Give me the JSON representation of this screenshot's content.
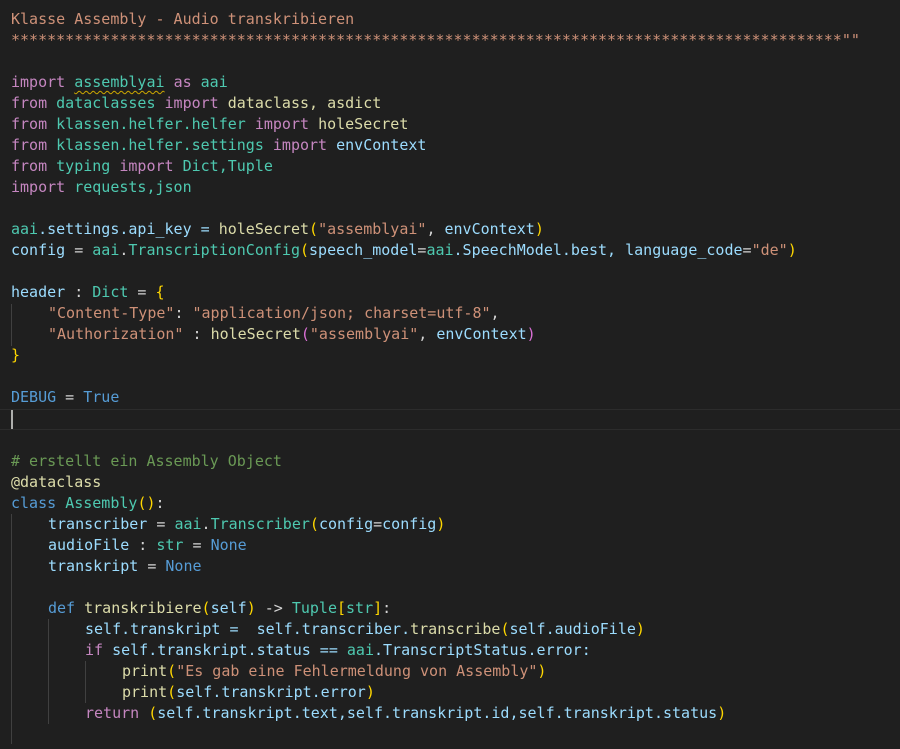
{
  "doc": {
    "l1": "Klasse Assembly - Audio transkribieren",
    "l2": "********************************************************************************************\"\"",
    "imp1_kw": "import",
    "imp1_mod": "assemblyai",
    "imp1_as": "as",
    "imp1_alias": "aai",
    "imp2_from": "from",
    "imp2_mod": "dataclasses",
    "imp2_import": "import",
    "imp2_names": "dataclass, asdict",
    "imp3_from": "from",
    "imp3_mod": "klassen.helfer.helfer",
    "imp3_import": "import",
    "imp3_names": "holeSecret",
    "imp4_from": "from",
    "imp4_mod": "klassen.helfer.settings",
    "imp4_import": "import",
    "imp4_names": "envContext",
    "imp5_from": "from",
    "imp5_mod": "typing",
    "imp5_import": "import",
    "imp5_names": "Dict,Tuple",
    "imp6_kw": "import",
    "imp6_names": "requests,json",
    "cfg1_a": "aai",
    "cfg1_b": ".settings.api_key = ",
    "cfg1_fn": "holeSecret",
    "cfg1_open": "(",
    "cfg1_str": "\"assemblyai\"",
    "cfg1_sep": ", ",
    "cfg1_arg": "envContext",
    "cfg1_close": ")",
    "cfg2_var": "config",
    "cfg2_eq": " = ",
    "cfg2_a": "aai",
    "cfg2_dot": ".",
    "cfg2_cls": "TranscriptionConfig",
    "cfg2_open": "(",
    "cfg2_p1": "speech_model",
    "cfg2_eq2": "=",
    "cfg2_a2": "aai",
    "cfg2_val": ".SpeechModel.best, ",
    "cfg2_p2": "language_code",
    "cfg2_eq3": "=",
    "cfg2_str": "\"de\"",
    "cfg2_close": ")",
    "hdr_var": "header",
    "hdr_colon": " : ",
    "hdr_type": "Dict",
    "hdr_eq": " = ",
    "hdr_open": "{",
    "hdr_k1": "\"Content-Type\"",
    "hdr_c1": ": ",
    "hdr_v1": "\"application/json; charset=utf-8\"",
    "hdr_comma": ",",
    "hdr_k2": "\"Authorization\"",
    "hdr_c2": " : ",
    "hdr_fn": "holeSecret",
    "hdr_p_open": "(",
    "hdr_v2": "\"assemblyai\"",
    "hdr_sep": ", ",
    "hdr_arg": "envContext",
    "hdr_p_close": ")",
    "hdr_close": "}",
    "dbg_var": "DEBUG",
    "dbg_eq": " = ",
    "dbg_val": "True",
    "comment": "# erstellt ein Assembly Object",
    "decorator": "@dataclass",
    "cls_kw": "class",
    "cls_name": "Assembly",
    "cls_paren": "()",
    "cls_colon": ":",
    "tr_var": "transcriber",
    "tr_eq": " = ",
    "tr_a": "aai",
    "tr_dot": ".",
    "tr_cls": "Transcriber",
    "tr_open": "(",
    "tr_p": "config",
    "tr_eq2": "=",
    "tr_arg": "config",
    "tr_close": ")",
    "af_var": "audioFile",
    "af_colon": " : ",
    "af_type": "str",
    "af_eq": " = ",
    "af_val": "None",
    "tk_var": "transkript",
    "tk_eq": " = ",
    "tk_val": "None",
    "def_kw": "def",
    "def_name": "transkribiere",
    "def_open": "(",
    "def_self": "self",
    "def_close": ")",
    "def_arrow": " -> ",
    "def_ret": "Tuple",
    "def_bo": "[",
    "def_str": "str",
    "def_bc": "]",
    "def_colon": ":",
    "b1_self": "self",
    "b1_attr": ".transkript = ",
    "b1_self2": "self",
    "b1_attr2": ".transcriber.",
    "b1_fn": "transcribe",
    "b1_open": "(",
    "b1_self3": "self",
    "b1_arg": ".audioFile",
    "b1_close": ")",
    "b2_if": "if",
    "b2_self": "self",
    "b2_cond": ".transkript.status == ",
    "b2_a": "aai",
    "b2_rest": ".TranscriptStatus.error:",
    "b3_fn": "print",
    "b3_open": "(",
    "b3_str": "\"Es gab eine Fehlermeldung von Assembly\"",
    "b3_close": ")",
    "b4_fn": "print",
    "b4_open": "(",
    "b4_self": "self",
    "b4_arg": ".transkript.error",
    "b4_close": ")",
    "b5_ret": "return",
    "b5_open": "(",
    "b5_s1": "self",
    "b5_a1": ".transkript.text,",
    "b5_s2": "self",
    "b5_a2": ".transkript.id,",
    "b5_s3": "self",
    "b5_a3": ".transkript.status",
    "b5_close": ")"
  }
}
